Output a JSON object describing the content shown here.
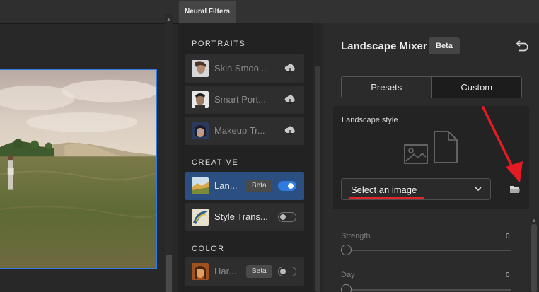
{
  "panel_tab": "Neural Filters",
  "sections": [
    {
      "header": "PORTRAITS",
      "items": [
        {
          "label": "Skin Smoo...",
          "state": "download"
        },
        {
          "label": "Smart Port...",
          "state": "download"
        },
        {
          "label": "Makeup Tr...",
          "state": "download"
        }
      ]
    },
    {
      "header": "CREATIVE",
      "items": [
        {
          "label": "Lan...",
          "badge": "Beta",
          "enabled": true
        },
        {
          "label": "Style Trans...",
          "enabled": false
        }
      ]
    },
    {
      "header": "COLOR",
      "items": [
        {
          "label": "Har...",
          "badge": "Beta",
          "enabled": false
        }
      ]
    }
  ],
  "settings": {
    "title": "Landscape Mixer",
    "badge": "Beta",
    "tabs": [
      "Presets",
      "Custom"
    ],
    "selected_tab": "Custom",
    "landscape_style_label": "Landscape style",
    "select_placeholder": "Select an image",
    "sliders": [
      {
        "label": "Strength",
        "value": "0"
      },
      {
        "label": "Day",
        "value": "0"
      }
    ]
  },
  "colors": {
    "accent": "#2f7be0",
    "active_item": "#2a4f80",
    "annotation_red": "#e0262b"
  }
}
